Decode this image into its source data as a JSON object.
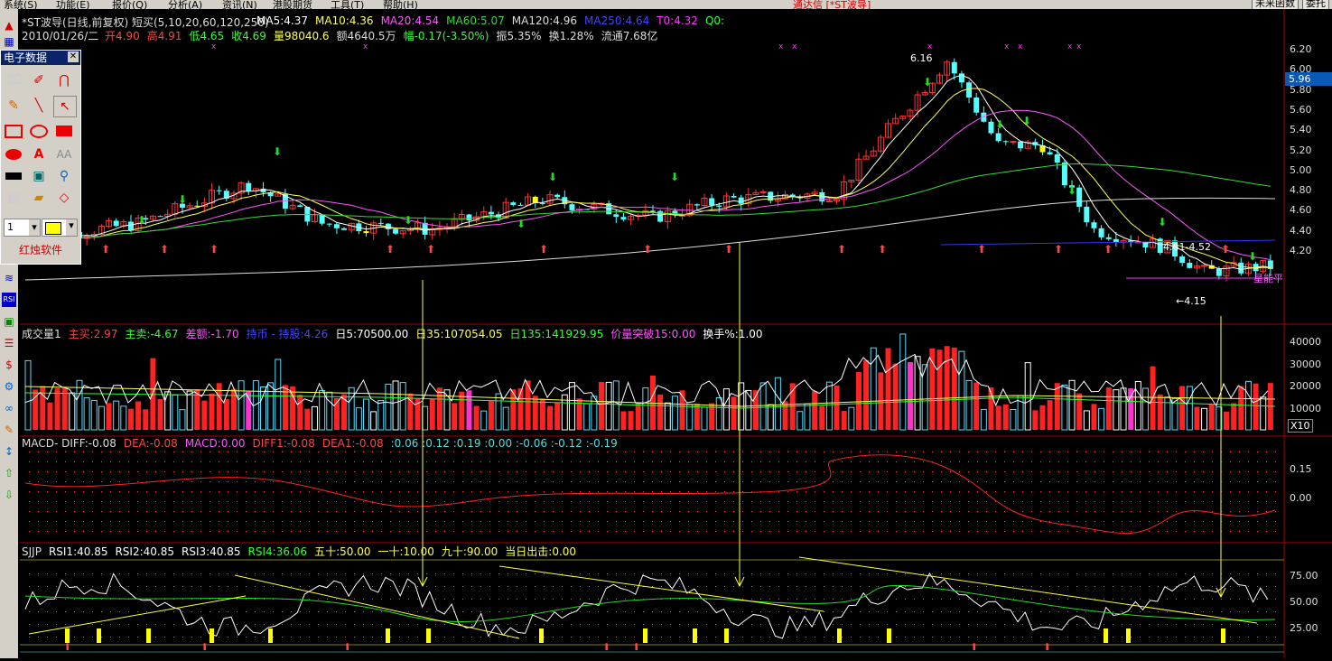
{
  "menu": {
    "items": [
      "系统(S)",
      "功能(E)",
      "报价(Q)",
      "分析(A)",
      "资讯(N)",
      "港股期货",
      "工具(T)",
      "帮助(H)"
    ],
    "title": "通达信 [*ST波导]",
    "right_buttons": [
      "未来函数",
      "委托"
    ]
  },
  "price": {
    "title": "*ST波导(日线,前复权) 短买(5,10,20,60,120,250)",
    "ma": [
      {
        "label": "MA5:4.37",
        "color": "#ffffff"
      },
      {
        "label": "MA10:4.36",
        "color": "#ffff55"
      },
      {
        "label": "MA20:4.54",
        "color": "#ff55ff"
      },
      {
        "label": "MA60:5.07",
        "color": "#33dd33"
      },
      {
        "label": "MA120:4.96",
        "color": "#dddddd"
      },
      {
        "label": "MA250:4.64",
        "color": "#4444ff"
      },
      {
        "label": "T0:4.32",
        "color": "#ff33ff"
      },
      {
        "label": "Q0:",
        "color": "#33ff33"
      }
    ],
    "info_date": "2010/01/26/二",
    "info": [
      {
        "label": "开4.90",
        "color": "#ff4444"
      },
      {
        "label": "高4.91",
        "color": "#ff4444"
      },
      {
        "label": "低4.65",
        "color": "#33ff33"
      },
      {
        "label": "收4.69",
        "color": "#33ff33"
      },
      {
        "label": "量98040.6",
        "color": "#ffff55"
      },
      {
        "label": "额4640.5万",
        "color": "#dddddd"
      },
      {
        "label": "幅-0.17(-3.50%)",
        "color": "#33ff33"
      },
      {
        "label": "振5.35%",
        "color": "#dddddd"
      },
      {
        "label": "换1.28%",
        "color": "#dddddd"
      },
      {
        "label": "流通7.68亿",
        "color": "#dddddd"
      }
    ],
    "y_ticks": [
      "6.20",
      "6.00",
      "5.80",
      "5.60",
      "5.40",
      "5.20",
      "5.00",
      "4.80",
      "4.60",
      "4.40",
      "4.20"
    ],
    "current_price": "5.96",
    "annotations": {
      "high": "6.16",
      "low": "←4.15",
      "range": "4.61-4.52",
      "star": "星能平"
    }
  },
  "volume": {
    "labels": [
      {
        "label": "成交量1",
        "color": "#dddddd"
      },
      {
        "label": "主买:2.97",
        "color": "#ff4444"
      },
      {
        "label": "主卖:-4.67",
        "color": "#33ff33"
      },
      {
        "label": "差额:-1.70",
        "color": "#ff55ff"
      },
      {
        "label": "持币 - 持股:4.26",
        "color": "#4444ff"
      },
      {
        "label": "日5:70500.00",
        "color": "#ffffff"
      },
      {
        "label": "日35:107054.05",
        "color": "#ffff55"
      },
      {
        "label": "日135:141929.95",
        "color": "#33ff33"
      },
      {
        "label": "价量突破15:0.00",
        "color": "#ff55ff"
      },
      {
        "label": "换手%:1.00",
        "color": "#ffffff"
      }
    ],
    "y_ticks": [
      "40000",
      "30000",
      "20000",
      "10000"
    ],
    "unit": "X10"
  },
  "macd": {
    "labels": [
      {
        "label": "MACD- DIFF:-0.08",
        "color": "#dddddd"
      },
      {
        "label": "DEA:-0.08",
        "color": "#ff4444"
      },
      {
        "label": "MACD:0.00",
        "color": "#ff55ff"
      },
      {
        "label": "DIFF1:-0.08",
        "color": "#ff4444"
      },
      {
        "label": "DEA1:-0.08",
        "color": "#ff4444"
      },
      {
        "label": ":0.06  :0.12  :0.19  :0.00  :-0.06  :-0.12  :-0.19",
        "color": "#55dddd"
      }
    ],
    "y_ticks": [
      "0.15",
      "0.00"
    ]
  },
  "sjjp": {
    "labels": [
      {
        "label": "SJJP",
        "color": "#dddddd"
      },
      {
        "label": "RSI1:40.85",
        "color": "#ffffff"
      },
      {
        "label": "RSI2:40.85",
        "color": "#ffffff"
      },
      {
        "label": "RSI3:40.85",
        "color": "#ffffff"
      },
      {
        "label": "RSI4:36.06",
        "color": "#33ff33"
      },
      {
        "label": "五十:50.00",
        "color": "#ffff55"
      },
      {
        "label": "一十:10.00",
        "color": "#ffff55"
      },
      {
        "label": "九十:90.00",
        "color": "#ffff55"
      },
      {
        "label": "当日出击:0.00",
        "color": "#ffff55"
      }
    ],
    "y_ticks": [
      "75.00",
      "50.00",
      "25.00"
    ]
  },
  "palette": {
    "title": "电子数据",
    "line_width": "1",
    "brand": "红烛软件"
  }
}
